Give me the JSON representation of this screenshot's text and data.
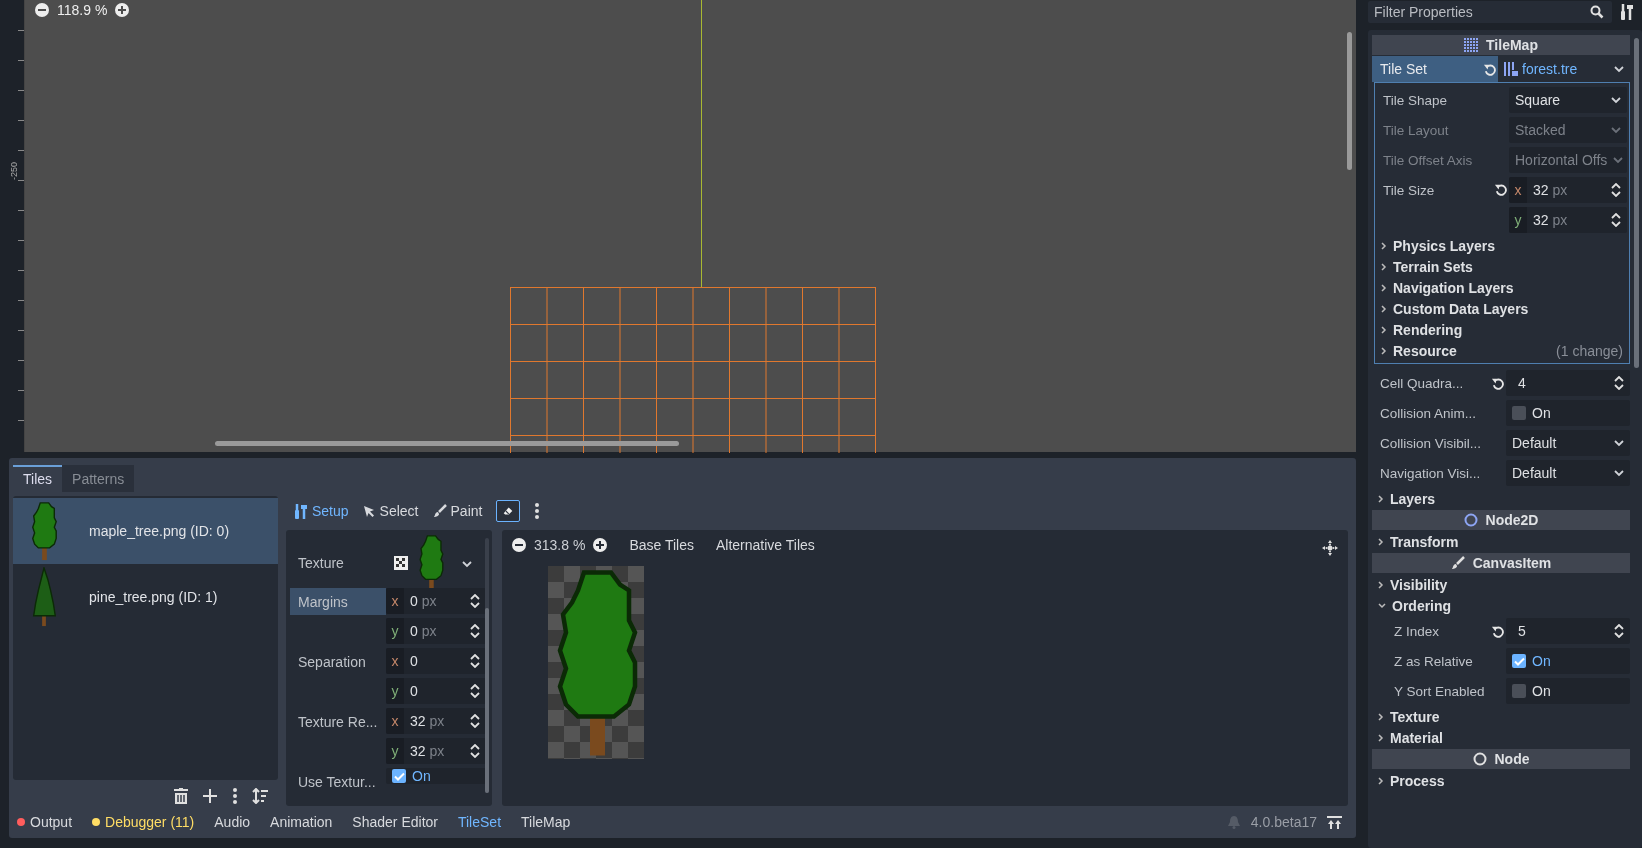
{
  "viewport": {
    "zoom": "118.9 %",
    "ruler_label": "-250"
  },
  "bottom_panel": {
    "tabs": [
      {
        "label": "Tiles",
        "selected": true
      },
      {
        "label": "Patterns",
        "selected": false
      }
    ],
    "sources": [
      {
        "name": "maple_tree.png (ID: 0)",
        "selected": true,
        "kind": "maple"
      },
      {
        "name": "pine_tree.png (ID: 1)",
        "selected": false,
        "kind": "pine"
      }
    ],
    "modes": [
      {
        "label": "Setup",
        "selected": true,
        "kind": "setup"
      },
      {
        "label": "Select",
        "selected": false,
        "kind": "select"
      },
      {
        "label": "Paint",
        "selected": false,
        "kind": "paint"
      }
    ],
    "eraser": {
      "on": true
    },
    "setup": [
      {
        "kind": "texture",
        "label": "Texture"
      },
      {
        "kind": "vector",
        "label": "Margins",
        "selected": true,
        "components": [
          {
            "axis": "x",
            "value": "0",
            "unit": "px"
          },
          {
            "axis": "y",
            "value": "0",
            "unit": "px"
          }
        ]
      },
      {
        "kind": "vector",
        "label": "Separation",
        "selected": false,
        "components": [
          {
            "axis": "x",
            "value": "0"
          },
          {
            "axis": "y",
            "value": "0"
          }
        ]
      },
      {
        "kind": "vector",
        "label": "Texture Re...",
        "selected": false,
        "components": [
          {
            "axis": "x",
            "value": "32",
            "unit": "px"
          },
          {
            "axis": "y",
            "value": "32",
            "unit": "px"
          }
        ]
      },
      {
        "kind": "check",
        "label": "Use Textur...",
        "checked": true,
        "value": "On"
      }
    ],
    "atlas": {
      "zoom": "313.8 %",
      "tabs": [
        "Base Tiles",
        "Alternative Tiles"
      ]
    }
  },
  "bottom_bar": {
    "items": [
      {
        "label": "Output",
        "color": "#ff5d5d",
        "warning": false,
        "selected": false
      },
      {
        "label": "Debugger (11)",
        "color": "#ffdd65",
        "warning": true,
        "selected": false
      },
      {
        "label": "Audio",
        "warning": false,
        "selected": false
      },
      {
        "label": "Animation",
        "warning": false,
        "selected": false
      },
      {
        "label": "Shader Editor",
        "warning": false,
        "selected": false
      },
      {
        "label": "TileSet",
        "warning": false,
        "selected": true
      },
      {
        "label": "TileMap",
        "warning": false,
        "selected": false
      }
    ],
    "version": "4.0.beta17"
  },
  "inspector": {
    "filter_placeholder": "Filter Properties",
    "rows": [
      {
        "kind": "category",
        "label": "TileMap"
      },
      {
        "kind": "resource",
        "label": "Tile Set",
        "value": "forest.tre",
        "revertable": true,
        "selected": true,
        "expanded": true,
        "children": [
          {
            "kind": "dropdown",
            "label": "Tile Shape",
            "value": "Square",
            "disabled": false
          },
          {
            "kind": "dropdown",
            "label": "Tile Layout",
            "value": "Stacked",
            "disabled": true
          },
          {
            "kind": "dropdown",
            "label": "Tile Offset Axis",
            "value": "Horizontal Offs",
            "disabled": true
          },
          {
            "kind": "vector",
            "label": "Tile Size",
            "revertable": true,
            "components": [
              {
                "axis": "x",
                "value": "32",
                "unit": "px"
              },
              {
                "axis": "y",
                "value": "32",
                "unit": "px"
              }
            ]
          },
          {
            "kind": "group",
            "label": "Physics Layers",
            "expanded": false
          },
          {
            "kind": "group",
            "label": "Terrain Sets",
            "expanded": false
          },
          {
            "kind": "group",
            "label": "Navigation Layers",
            "expanded": false
          },
          {
            "kind": "group",
            "label": "Custom Data Layers",
            "expanded": false
          },
          {
            "kind": "group",
            "label": "Rendering",
            "expanded": false
          },
          {
            "kind": "group",
            "label": "Resource",
            "expanded": false,
            "note": "(1 change)"
          }
        ]
      },
      {
        "kind": "number",
        "label": "Cell Quadra...",
        "value": "4",
        "revertable": true
      },
      {
        "kind": "check",
        "label": "Collision Anim...",
        "checked": false,
        "value": "On"
      },
      {
        "kind": "dropdown",
        "label": "Collision Visibil...",
        "value": "Default",
        "disabled": false
      },
      {
        "kind": "dropdown",
        "label": "Navigation Visi...",
        "value": "Default",
        "disabled": false
      },
      {
        "kind": "group",
        "label": "Layers",
        "expanded": false
      },
      {
        "kind": "category",
        "label": "Node2D"
      },
      {
        "kind": "group",
        "label": "Transform",
        "expanded": false
      },
      {
        "kind": "category",
        "label": "CanvasItem"
      },
      {
        "kind": "group",
        "label": "Visibility",
        "expanded": false
      },
      {
        "kind": "group",
        "label": "Ordering",
        "expanded": true,
        "children": [
          {
            "kind": "number",
            "label": "Z Index",
            "value": "5",
            "revertable": true
          },
          {
            "kind": "check",
            "label": "Z as Relative",
            "checked": true,
            "value": "On"
          },
          {
            "kind": "check",
            "label": "Y Sort Enabled",
            "checked": false,
            "value": "On"
          }
        ]
      },
      {
        "kind": "group",
        "label": "Texture",
        "expanded": false
      },
      {
        "kind": "group",
        "label": "Material",
        "expanded": false
      },
      {
        "kind": "category",
        "label": "Node"
      },
      {
        "kind": "group",
        "label": "Process",
        "expanded": false
      }
    ]
  }
}
